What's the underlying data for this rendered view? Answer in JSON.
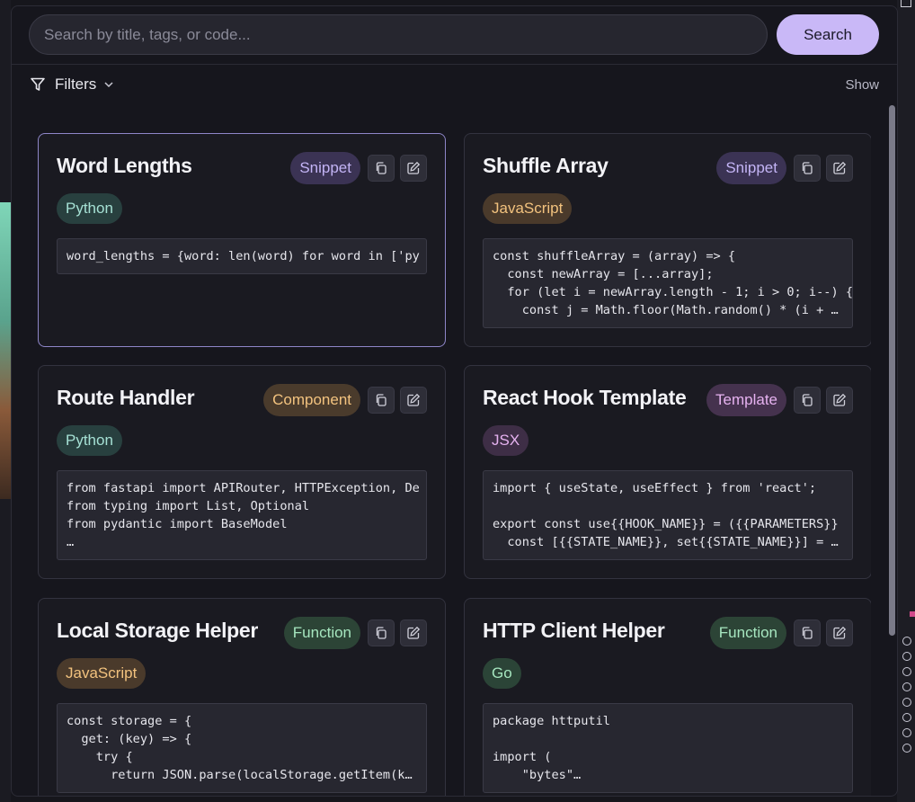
{
  "search": {
    "placeholder": "Search by title, tags, or code...",
    "button_label": "Search"
  },
  "filters": {
    "label": "Filters",
    "toggle_label": "Show"
  },
  "colors": {
    "accent": "#c9b8f7",
    "badge_snippet_bg": "#3b3354",
    "badge_snippet_fg": "#c3b4f5",
    "badge_component_bg": "#4a3b2c",
    "badge_component_fg": "#f3c37f",
    "badge_template_bg": "#45324e",
    "badge_template_fg": "#e6b2f0",
    "badge_function_bg": "#2c4436",
    "badge_function_fg": "#a6e6bf",
    "lang_python_bg": "#28403f",
    "lang_python_fg": "#a5e0d4",
    "lang_javascript_bg": "#4a3a2b",
    "lang_javascript_fg": "#f2c27e",
    "lang_jsx_bg": "#3e2e46",
    "lang_jsx_fg": "#e6b2f0",
    "lang_go_bg": "#2b4437",
    "lang_go_fg": "#a6e6bf"
  },
  "cards": [
    {
      "title": "Word Lengths",
      "type": "Snippet",
      "language": "Python",
      "code": "word_lengths = {word: len(word) for word in ['py"
    },
    {
      "title": "Shuffle Array",
      "type": "Snippet",
      "language": "JavaScript",
      "code": "const shuffleArray = (array) => {\n  const newArray = [...array];\n  for (let i = newArray.length - 1; i > 0; i--) {\n    const j = Math.floor(Math.random() * (i + …"
    },
    {
      "title": "Route Handler",
      "type": "Component",
      "language": "Python",
      "code": "from fastapi import APIRouter, HTTPException, De\nfrom typing import List, Optional\nfrom pydantic import BaseModel\n…"
    },
    {
      "title": "React Hook Template",
      "type": "Template",
      "language": "JSX",
      "code": "import { useState, useEffect } from 'react';\n\nexport const use{{HOOK_NAME}} = ({{PARAMETERS}}\n  const [{{STATE_NAME}}, set{{STATE_NAME}}] = …"
    },
    {
      "title": "Local Storage Helper",
      "type": "Function",
      "language": "JavaScript",
      "code": "const storage = {\n  get: (key) => {\n    try {\n      return JSON.parse(localStorage.getItem(k…"
    },
    {
      "title": "HTTP Client Helper",
      "type": "Function",
      "language": "Go",
      "code": "package httputil\n\nimport (\n    \"bytes\"…"
    }
  ]
}
